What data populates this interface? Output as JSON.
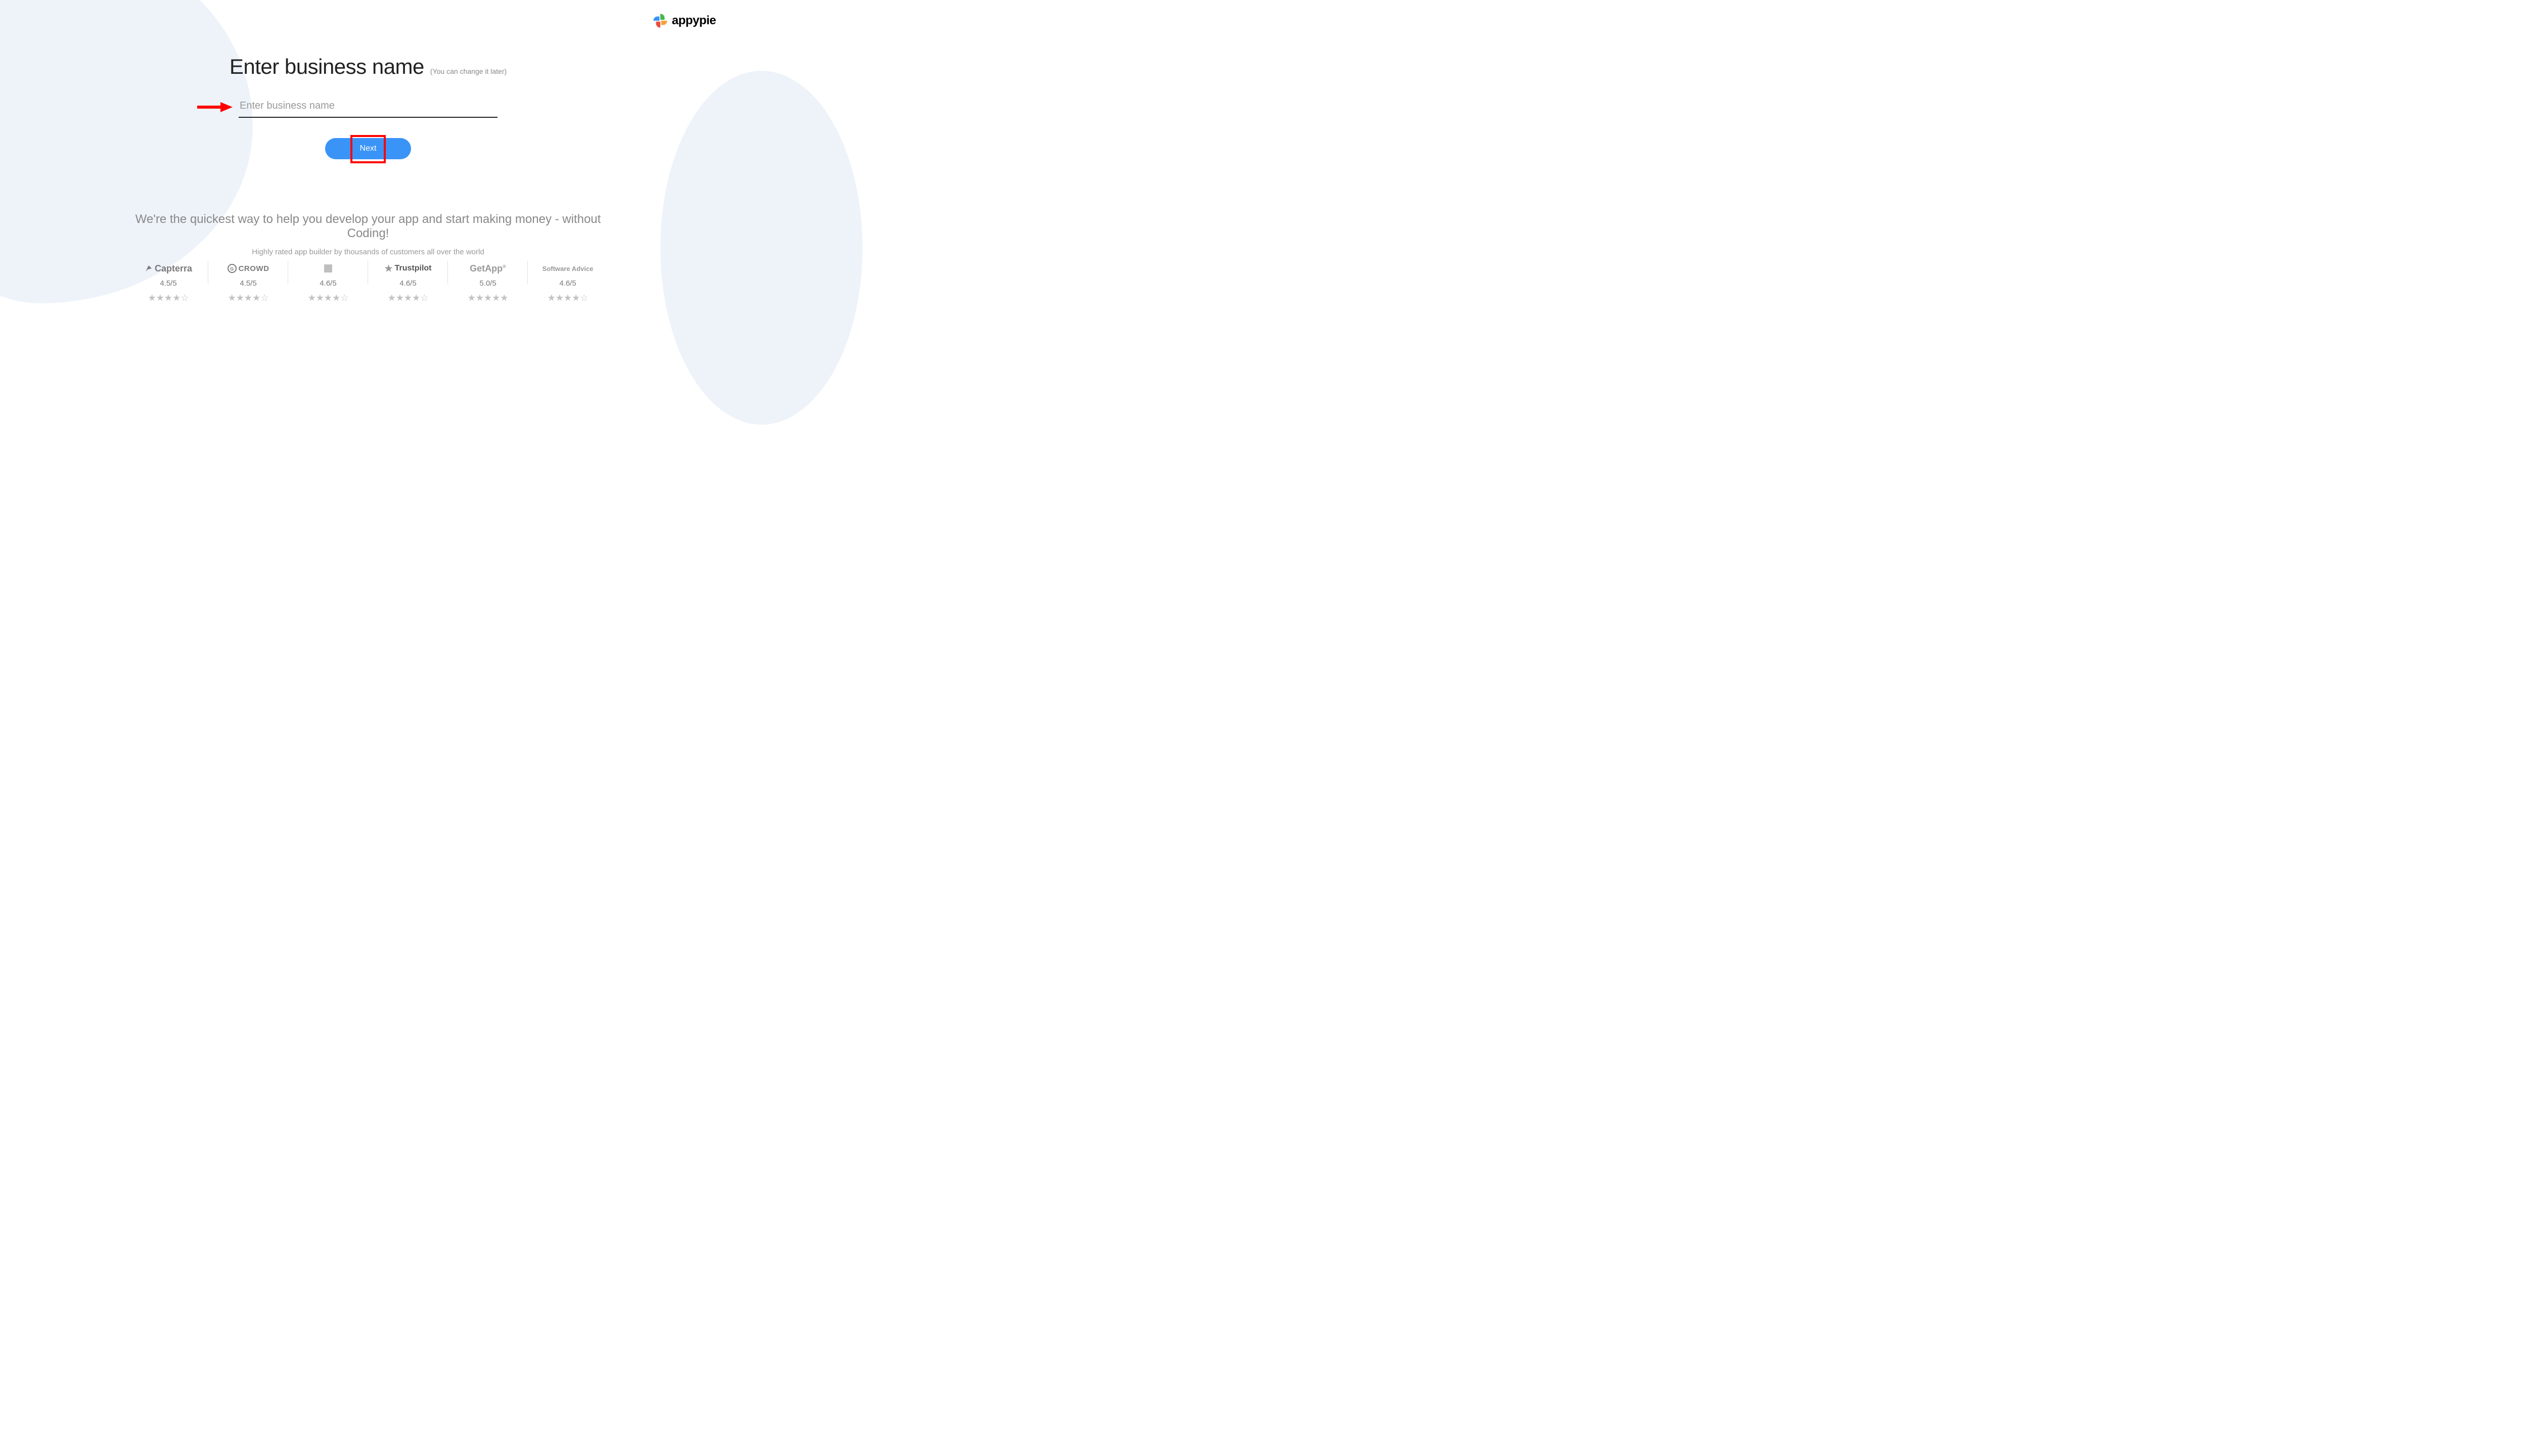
{
  "brand": {
    "name": "appypie"
  },
  "form": {
    "title": "Enter business name",
    "title_hint": "(You can change it later)",
    "input_placeholder": "Enter business name",
    "input_value": "",
    "next_label": "Next"
  },
  "tagline": {
    "main": "We're the quickest way to help you develop your app and start making money - without Coding!",
    "sub": "Highly rated app builder by thousands of customers all over the world"
  },
  "ratings": [
    {
      "name": "Capterra",
      "score": "4.5/5",
      "stars": "★★★★☆"
    },
    {
      "name": "G2 CROWD",
      "score": "4.5/5",
      "stars": "★★★★☆"
    },
    {
      "name": "",
      "score": "4.6/5",
      "stars": "★★★★☆"
    },
    {
      "name": "Trustpilot",
      "score": "4.6/5",
      "stars": "★★★★☆"
    },
    {
      "name": "GetApp",
      "score": "5.0/5",
      "stars": "★★★★★"
    },
    {
      "name": "Software Advice",
      "score": "4.6/5",
      "stars": "★★★★☆"
    }
  ]
}
